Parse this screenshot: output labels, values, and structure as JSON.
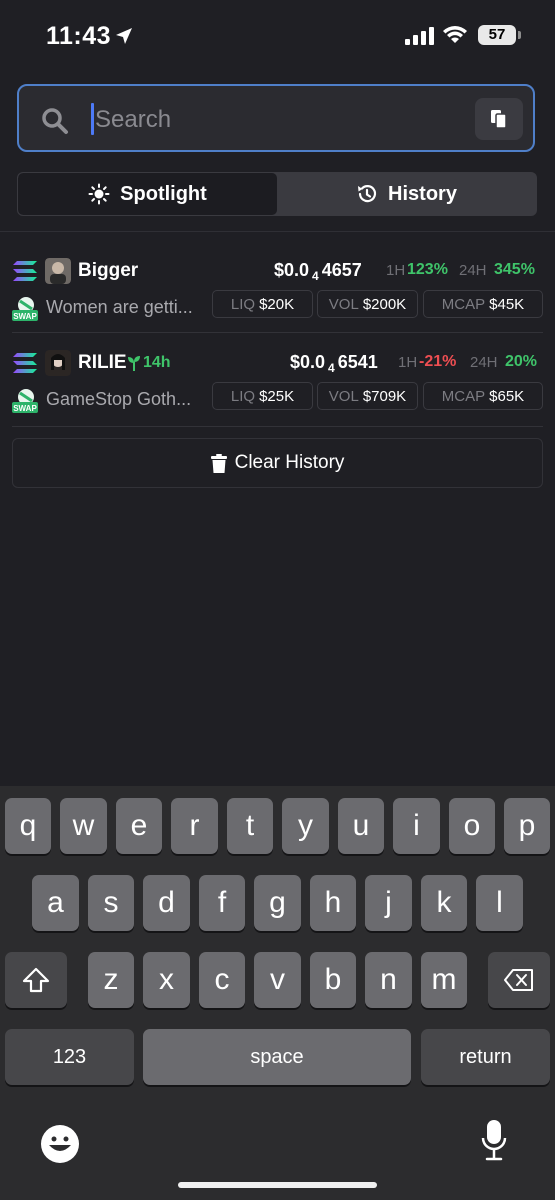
{
  "status": {
    "time": "11:43",
    "battery": "57"
  },
  "search": {
    "placeholder": "Search",
    "value": ""
  },
  "tabs": [
    {
      "label": "Spotlight",
      "icon": "sun-icon",
      "active": true
    },
    {
      "label": "History",
      "icon": "history-icon",
      "active": false
    }
  ],
  "tokens": [
    {
      "name": "Bigger",
      "age": "",
      "description": "Women are getti...",
      "price_prefix": "$0.0",
      "price_zeros": "4",
      "price_digits": "4657",
      "h1_label": "1H",
      "h1_value": "123%",
      "h1_color": "#3fc46a",
      "h24_label": "24H",
      "h24_value": "345%",
      "h24_color": "#3fc46a",
      "liq_label": "LIQ",
      "liq_value": "$20K",
      "vol_label": "VOL",
      "vol_value": "$200K",
      "mcap_label": "MCAP",
      "mcap_value": "$45K"
    },
    {
      "name": "RILIE",
      "age": "14h",
      "description": "GameStop Goth...",
      "price_prefix": "$0.0",
      "price_zeros": "4",
      "price_digits": "6541",
      "h1_label": "1H",
      "h1_value": "-21%",
      "h1_color": "#ee4e52",
      "h24_label": "24H",
      "h24_value": "20%",
      "h24_color": "#3fc46a",
      "liq_label": "LIQ",
      "liq_value": "$25K",
      "vol_label": "VOL",
      "vol_value": "$709K",
      "mcap_label": "MCAP",
      "mcap_value": "$65K"
    }
  ],
  "swap_badge": "SWAP",
  "clear_history": "Clear History",
  "keyboard": {
    "row1": [
      "q",
      "w",
      "e",
      "r",
      "t",
      "y",
      "u",
      "i",
      "o",
      "p"
    ],
    "row2": [
      "a",
      "s",
      "d",
      "f",
      "g",
      "h",
      "j",
      "k",
      "l"
    ],
    "row3": [
      "z",
      "x",
      "c",
      "v",
      "b",
      "n",
      "m"
    ],
    "numbers": "123",
    "space": "space",
    "return": "return"
  },
  "colors": {
    "accent": "#4f7fc9",
    "positive": "#3fc46a",
    "negative": "#ee4e52",
    "background": "#1f1f24"
  }
}
